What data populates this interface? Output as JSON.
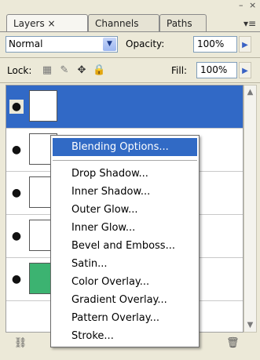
{
  "tabs": [
    {
      "label": "Layers ×"
    },
    {
      "label": "Channels"
    },
    {
      "label": "Paths"
    }
  ],
  "window_controls": {
    "minimize": "–",
    "close": "×",
    "menu": "▾≡"
  },
  "blend": {
    "mode": "Normal",
    "opacity_label": "Opacity:",
    "opacity_value": "100%"
  },
  "lock": {
    "label": "Lock:",
    "fill_label": "Fill:",
    "fill_value": "100%"
  },
  "icons": {
    "eye": "eye-icon",
    "link": "link-layers-icon",
    "trash": "trash-icon",
    "lock_transparent": "lock-transparent-icon",
    "lock_image": "lock-image-icon",
    "lock_position": "lock-position-icon",
    "lock_all": "lock-all-icon"
  },
  "context_menu": {
    "highlighted": "Blending Options...",
    "items": [
      "Drop Shadow...",
      "Inner Shadow...",
      "Outer Glow...",
      "Inner Glow...",
      "Bevel and Emboss...",
      "Satin...",
      "Color Overlay...",
      "Gradient Overlay...",
      "Pattern Overlay...",
      "Stroke..."
    ]
  },
  "colors": {
    "selection": "#316ac5",
    "panel": "#ece9d8"
  }
}
